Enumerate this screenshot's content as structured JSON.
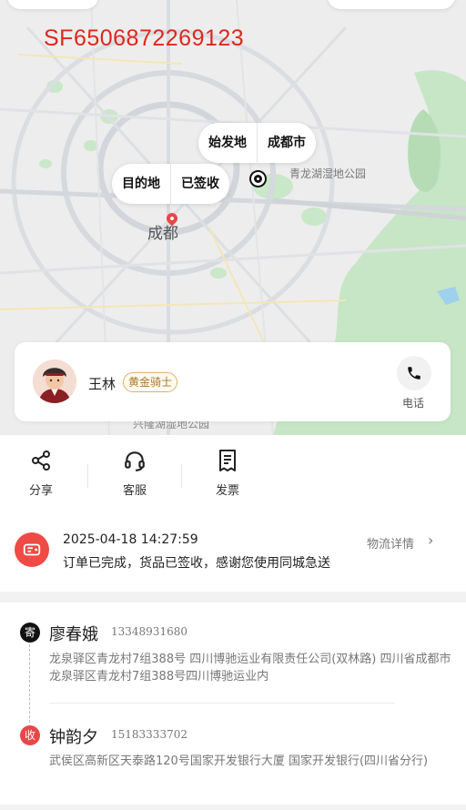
{
  "map": {
    "tracking_number": "SF6506872269123",
    "city_label": "成都",
    "park_label": "青龙湖湿地公园",
    "park_label_2": "兴隆湖湿地公园",
    "origin_bubble": {
      "label": "始发地",
      "value": "成都市"
    },
    "destination_bubble": {
      "label": "目的地",
      "value": "已签收"
    }
  },
  "rider": {
    "name": "王林",
    "badge": "黄金骑士",
    "call_label": "电话"
  },
  "actions": [
    {
      "label": "分享",
      "icon": "share-icon"
    },
    {
      "label": "客服",
      "icon": "headset-icon"
    },
    {
      "label": "发票",
      "icon": "invoice-icon"
    }
  ],
  "status": {
    "icon": "delivery-truck-icon",
    "time": "2025-04-18 14:27:59",
    "message": "订单已完成，货品已签收，感谢您使用同城急送",
    "detail_link": "物流详情"
  },
  "sender": {
    "tag": "寄",
    "name": "廖春娥",
    "phone": "13348931680",
    "address": "龙泉驿区青龙村7组388号 四川博驰运业有限责任公司(双林路) 四川省成都市龙泉驿区青龙村7组388号四川博驰运业内"
  },
  "receiver": {
    "tag": "收",
    "name": "钟韵夕",
    "phone": "15183333702",
    "address": "武侯区高新区天泰路120号国家开发银行大厦 国家开发银行(四川省分行)"
  },
  "colors": {
    "accent_red": "#e0261d",
    "status_red": "#ef4a45",
    "badge_gold": "#a87a2a",
    "map_green": "#c6e6c6"
  }
}
